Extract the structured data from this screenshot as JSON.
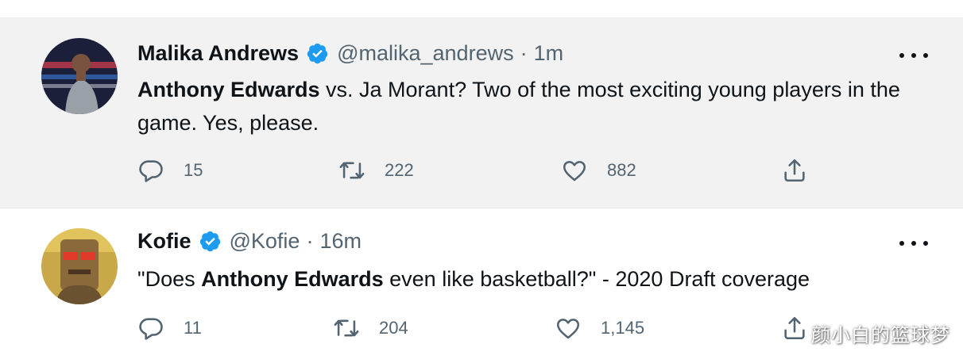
{
  "tweets": [
    {
      "name": "Malika Andrews",
      "handle": "@malika_andrews",
      "dot": "·",
      "time": "1m",
      "text_bold": "Anthony Edwards",
      "text_rest": " vs. Ja Morant? Two of the most exciting young players in the game. Yes, please.",
      "replies": "15",
      "retweets": "222",
      "likes": "882"
    },
    {
      "name": "Kofie",
      "handle": "@Kofie",
      "dot": "·",
      "time": "16m",
      "text_before": "\"Does ",
      "text_bold": "Anthony Edwards",
      "text_after": " even like basketball?\" - 2020 Draft coverage",
      "replies": "11",
      "retweets": "204",
      "likes": "1,145"
    }
  ],
  "watermark": "颜小白的篮球梦",
  "colors": {
    "verified": "#1d9bf0",
    "muted": "#536471",
    "highlight_bg": "#f2f2f2"
  },
  "icons": [
    "verified-badge-icon",
    "more-icon",
    "reply-icon",
    "retweet-icon",
    "like-icon",
    "share-icon"
  ]
}
